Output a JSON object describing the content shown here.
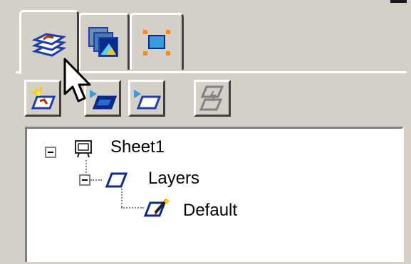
{
  "tabs": [
    {
      "icon": "layers-stack-icon"
    },
    {
      "icon": "views-stack-icon"
    },
    {
      "icon": "selection-frame-icon"
    }
  ],
  "toolbar": {
    "buttons": [
      {
        "icon": "new-layer-icon"
      },
      {
        "icon": "set-active-layer-icon"
      },
      {
        "icon": "layer-properties-icon"
      },
      {
        "icon": "merge-layers-icon"
      }
    ]
  },
  "tree": {
    "sheet": {
      "label": "Sheet1",
      "icon": "sheet-icon"
    },
    "layers": {
      "label": "Layers",
      "icon": "layers-icon"
    },
    "default_layer": {
      "label": "Default",
      "icon": "default-layer-icon"
    }
  },
  "colors": {
    "face": "#d4d0c8",
    "highlight": "#ffffff",
    "shadow": "#808080",
    "accent_blue": "#1c3fa8",
    "accent_red": "#cc2200",
    "accent_orange": "#ff8c1a"
  }
}
